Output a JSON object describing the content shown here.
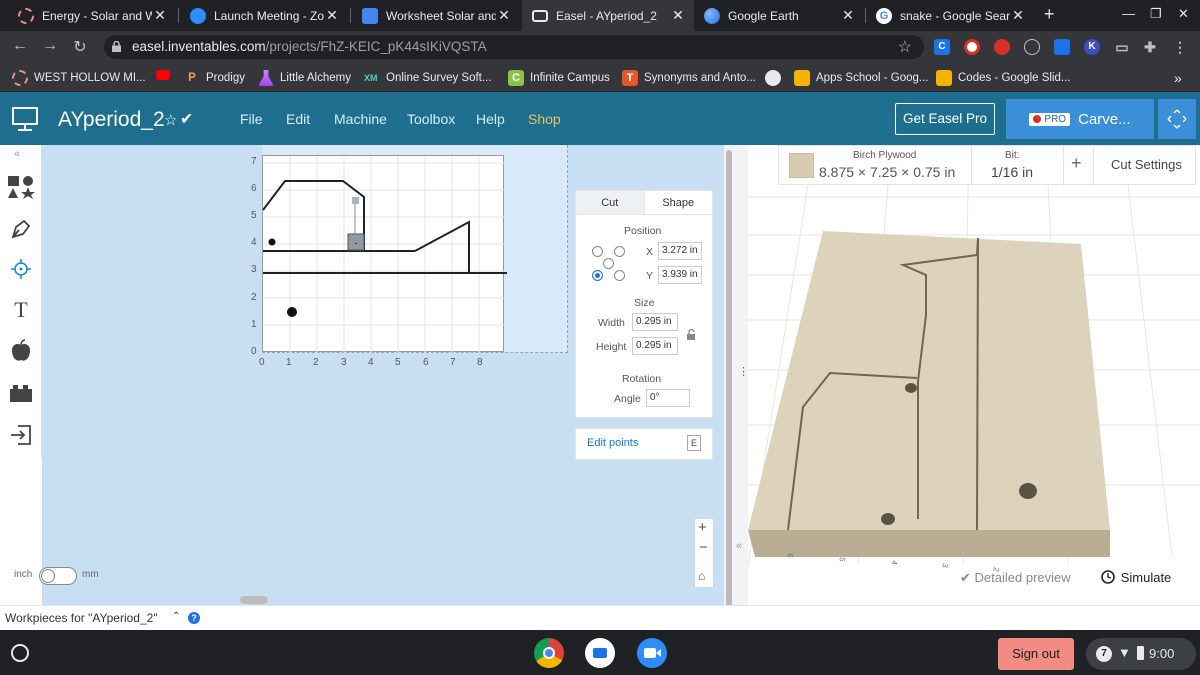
{
  "tabs": [
    {
      "title": "Energy - Solar and Win",
      "active": false
    },
    {
      "title": "Launch Meeting - Zoom",
      "active": false
    },
    {
      "title": "Worksheet Solar and W",
      "active": false
    },
    {
      "title": "Easel - AYperiod_2",
      "active": true
    },
    {
      "title": "Google Earth",
      "active": false
    },
    {
      "title": "snake - Google Search",
      "active": false
    }
  ],
  "new_tab_label": "+",
  "address": {
    "host": "easel.inventables.com",
    "path": "/projects/FhZ-KEIC_pK44sIKiVQSTA"
  },
  "bookmarks": [
    {
      "label": "WEST HOLLOW MI..."
    },
    {
      "label": ""
    },
    {
      "label": "Prodigy"
    },
    {
      "label": "Little Alchemy"
    },
    {
      "label": "Online Survey Soft..."
    },
    {
      "label": "Infinite Campus"
    },
    {
      "label": "Synonyms and Anto..."
    },
    {
      "label": ""
    },
    {
      "label": "Apps School - Goog..."
    },
    {
      "label": "Codes - Google Slid..."
    }
  ],
  "bookmarks_more": "»",
  "extensions": [
    "C",
    "K"
  ],
  "header": {
    "project_name": "AYperiod_2",
    "menus": [
      "File",
      "Edit",
      "Machine",
      "Toolbox",
      "Help",
      "Shop"
    ],
    "get_pro": "Get Easel Pro",
    "pro_badge": "PRO",
    "carve": "Carve..."
  },
  "canvas": {
    "y_ticks": [
      "7",
      "6",
      "5",
      "4",
      "3",
      "2",
      "1",
      "0"
    ],
    "x_ticks": [
      "0",
      "1",
      "2",
      "3",
      "4",
      "5",
      "6",
      "7",
      "8"
    ]
  },
  "panel": {
    "tab_cut": "Cut",
    "tab_shape": "Shape",
    "position_label": "Position",
    "x_label": "X",
    "x_value": "3.272 in",
    "y_label": "Y",
    "y_value": "3.939 in",
    "size_label": "Size",
    "width_label": "Width",
    "width_value": "0.295 in",
    "height_label": "Height",
    "height_value": "0.295 in",
    "rotation_label": "Rotation",
    "angle_label": "Angle",
    "angle_value": "0°",
    "edit_points": "Edit points",
    "edit_points_key": "E"
  },
  "units": {
    "left": "inch",
    "right": "mm"
  },
  "material": {
    "name": "Birch Plywood",
    "dims": "8.875 × 7.25 × 0.75 in",
    "bit_label": "Bit:",
    "bit_value": "1/16 in",
    "add": "+",
    "cut_settings": "Cut Settings"
  },
  "preview": {
    "detailed": "Detailed preview",
    "simulate": "Simulate",
    "axis_labels": [
      "6",
      "5",
      "4",
      "3",
      "2"
    ]
  },
  "workpieces": "Workpieces for \"AYperiod_2\"",
  "shelf": {
    "sign_out": "Sign out",
    "badge": "7",
    "time": "9:00"
  }
}
